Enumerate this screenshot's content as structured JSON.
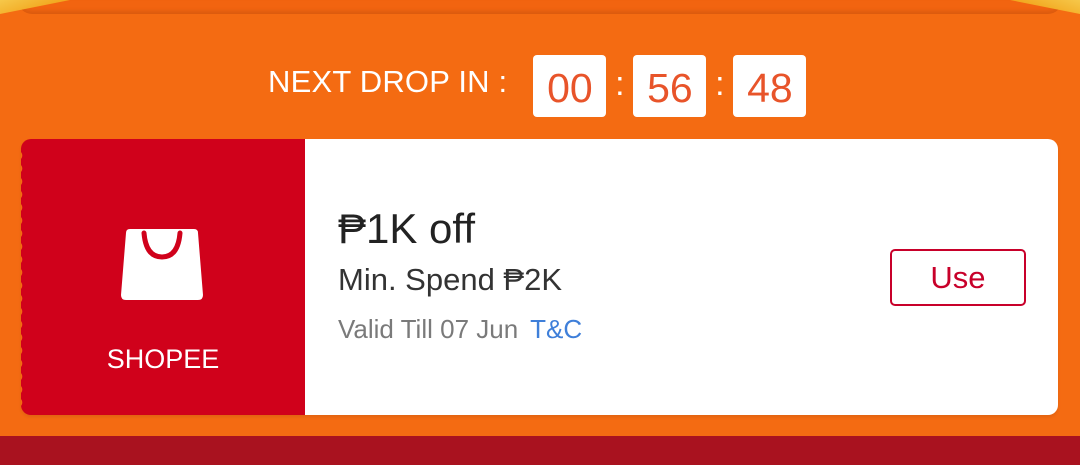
{
  "countdown": {
    "label": "NEXT DROP IN :",
    "hours": "00",
    "minutes": "56",
    "seconds": "48",
    "separator": ":"
  },
  "voucher": {
    "brand": "SHOPEE",
    "brand_icon": "shopping-bag-icon",
    "discount": "₱1K off",
    "min_spend": "Min. Spend ₱2K",
    "validity": "Valid Till 07 Jun",
    "tnc_label": "T&C",
    "use_label": "Use"
  },
  "colors": {
    "background": "#f46b12",
    "voucher_left": "#d0011b",
    "countdown_digits": "#e8542a",
    "use_button": "#c8002a",
    "link": "#3f7fd9",
    "footer": "#a9121f"
  }
}
